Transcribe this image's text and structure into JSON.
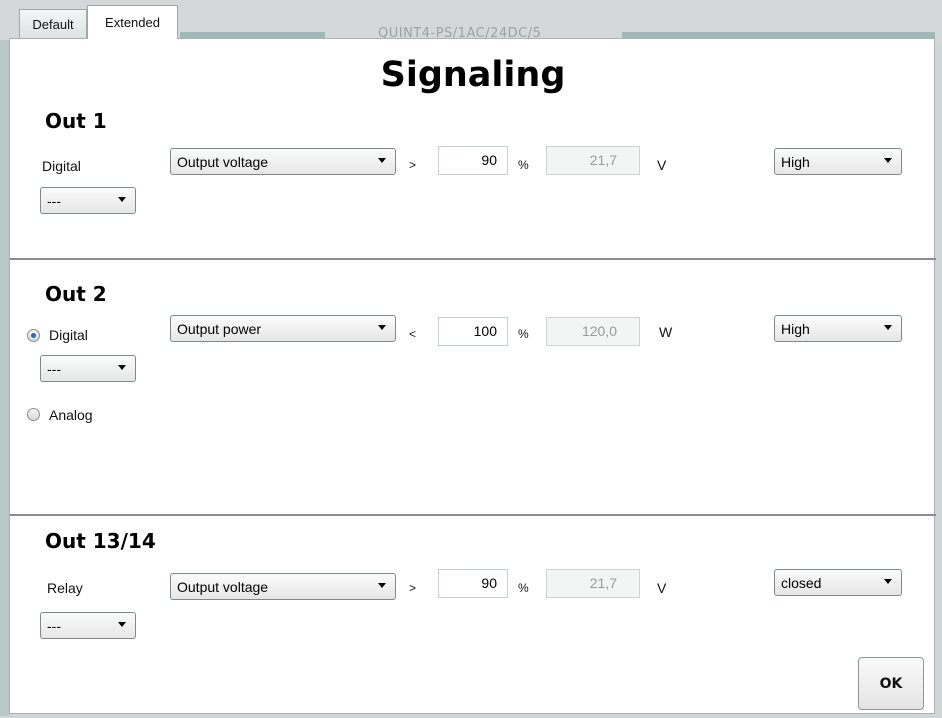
{
  "tabs": [
    {
      "label": "Default",
      "active": false
    },
    {
      "label": "Extended",
      "active": true
    }
  ],
  "background_title": "QUINT4-PS/1AC/24DC/5",
  "dialog": {
    "title": "Signaling",
    "ok_label": "OK"
  },
  "sections": [
    {
      "title": "Out 1",
      "mode_label": "Digital",
      "sub_select": "---",
      "signal": "Output voltage",
      "operator": ">",
      "threshold": "90",
      "threshold_unit": "%",
      "computed": "21,7",
      "computed_unit": "V",
      "state": "High"
    },
    {
      "title": "Out 2",
      "mode_label": "Digital",
      "mode_alt_label": "Analog",
      "selected_mode": "Digital",
      "sub_select": "---",
      "signal": "Output power",
      "operator": "<",
      "threshold": "100",
      "threshold_unit": "%",
      "computed": "120,0",
      "computed_unit": "W",
      "state": "High"
    },
    {
      "title": "Out 13/14",
      "mode_label": "Relay",
      "sub_select": "---",
      "signal": "Output voltage",
      "operator": ">",
      "threshold": "90",
      "threshold_unit": "%",
      "computed": "21,7",
      "computed_unit": "V",
      "state": "closed"
    }
  ],
  "colors": {
    "radio_selected": "#2b6fb8",
    "divider": "#8c8c8c",
    "window_background": "#cfd6d6"
  }
}
